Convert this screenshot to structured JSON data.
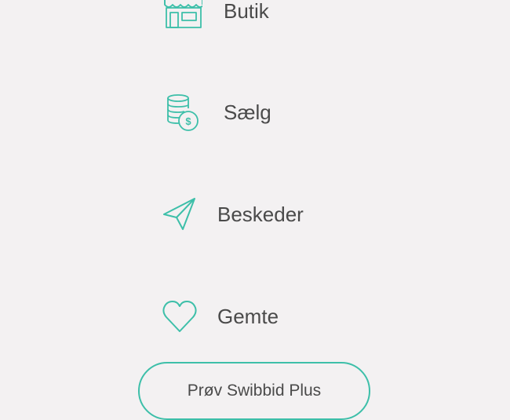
{
  "menu": {
    "items": [
      {
        "label": "Butik",
        "icon": "shop-icon"
      },
      {
        "label": "Sælg",
        "icon": "coins-dollar-icon"
      },
      {
        "label": "Beskeder",
        "icon": "paper-plane-icon"
      },
      {
        "label": "Gemte",
        "icon": "heart-icon"
      }
    ]
  },
  "plus_button": {
    "label": "Prøv Swibbid Plus"
  },
  "colors": {
    "background": "#f3f1f2",
    "accent": "#3dbfa9",
    "text": "#4a4a4a"
  }
}
